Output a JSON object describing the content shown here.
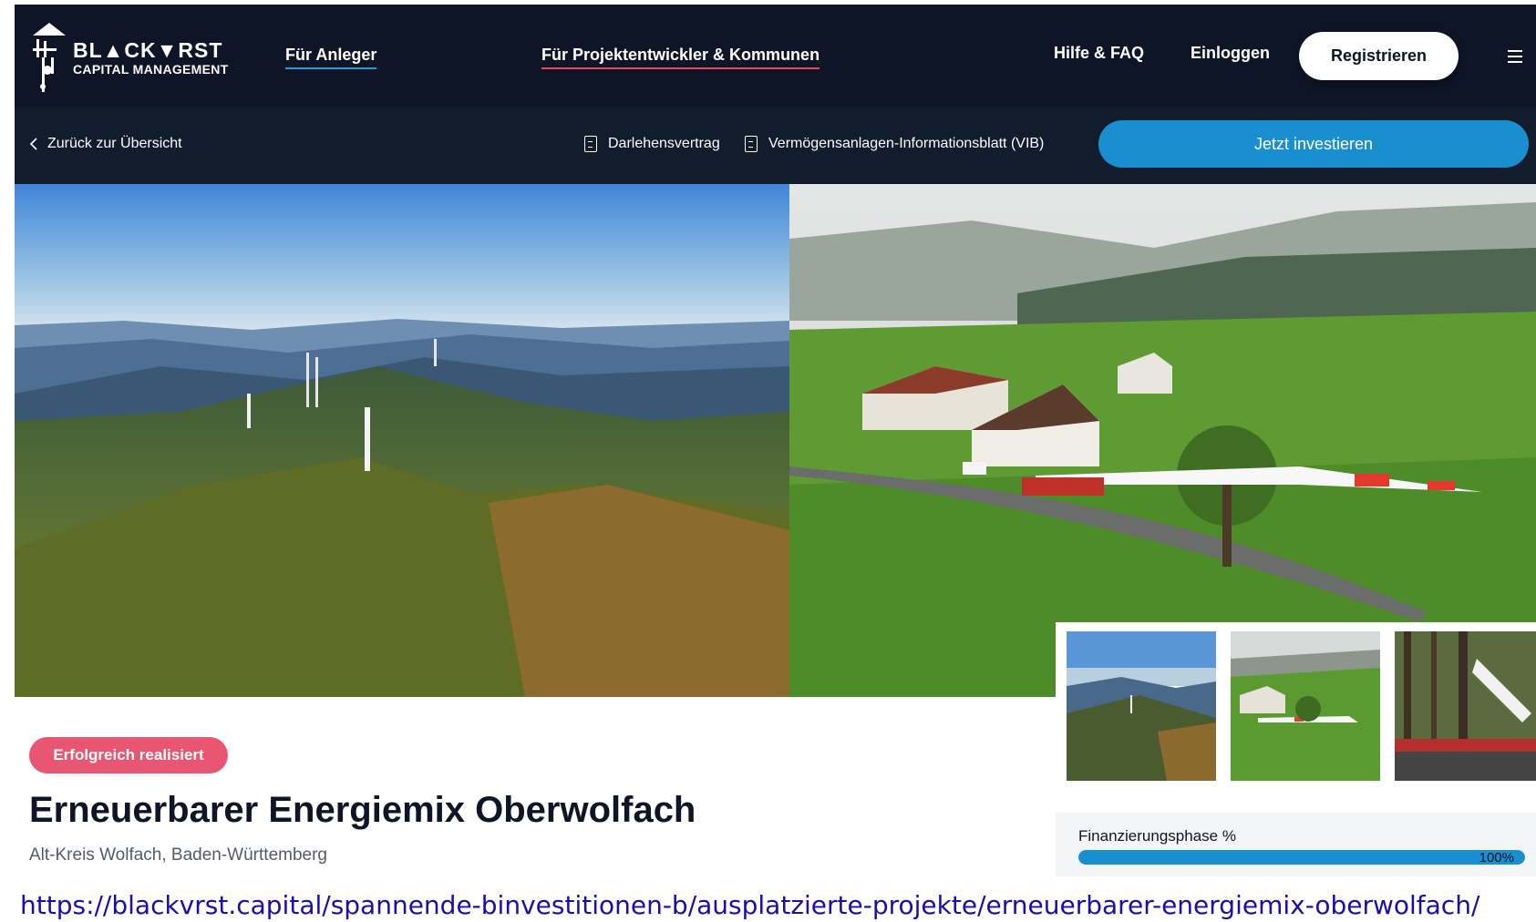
{
  "brand": {
    "line1": "BL▲CK▼RST",
    "line2": "CAPITAL MANAGEMENT",
    "logo_icon": "wind-turbine-house-icon"
  },
  "nav": {
    "anleger": "Für Anleger",
    "projekt": "Für Projektentwickler & Kommunen",
    "hilfe": "Hilfe & FAQ",
    "login": "Einloggen",
    "register": "Registrieren",
    "menu_icon": "hamburger-menu-icon"
  },
  "subnav": {
    "back": "Zurück zur Übersicht",
    "doc1": "Darlehensvertrag",
    "doc2": "Vermögensanlagen-Informationsblatt (VIB)",
    "invest": "Jetzt investieren"
  },
  "project": {
    "status": "Erfolgreich realisiert",
    "title": "Erneuerbarer Energiemix Oberwolfach",
    "location": "Alt-Kreis Wolfach, Baden-Württemberg"
  },
  "funding": {
    "label": "Finanzierungsphase %",
    "percent_text": "100%",
    "percent_value": 100
  },
  "gallery": {
    "images": [
      "aerial-forest-wind-turbines",
      "farm-turbine-blade-transport",
      "forest-turbine-transport"
    ]
  },
  "colors": {
    "navy": "#0d1527",
    "accent_blue": "#1a8fcf",
    "accent_pink": "#e85671"
  },
  "url": "https://blackvrst.capital/spannende-binvestitionen-b/ausplatzierte-projekte/erneuerbarer-energiemix-oberwolfach/"
}
